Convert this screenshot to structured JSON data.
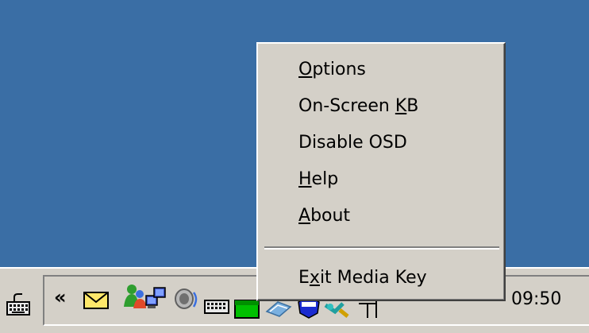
{
  "menu": {
    "items": [
      {
        "pre": "",
        "key": "O",
        "post": "ptions"
      },
      {
        "pre": "On-Screen ",
        "key": "K",
        "post": "B"
      },
      {
        "pre": "Disable OSD",
        "key": "",
        "post": ""
      },
      {
        "pre": "",
        "key": "H",
        "post": "elp"
      },
      {
        "pre": "",
        "key": "A",
        "post": "bout"
      },
      {
        "pre": "E",
        "key": "x",
        "post": "it Media Key"
      }
    ]
  },
  "tray": {
    "chevron": "«",
    "clock": "09:50",
    "icons": [
      "keyboard-icon",
      "mail-icon",
      "messenger-icon",
      "network-icon",
      "volume-icon",
      "keyboard-tray-icon",
      "battery-icon",
      "display-icon",
      "shield-icon",
      "connection-icon",
      "antenna-icon"
    ]
  },
  "colors": {
    "desktop": "#3a6ea5",
    "menu_bg": "#d4d0c8",
    "taskbar_bg": "#d4d0c8"
  }
}
